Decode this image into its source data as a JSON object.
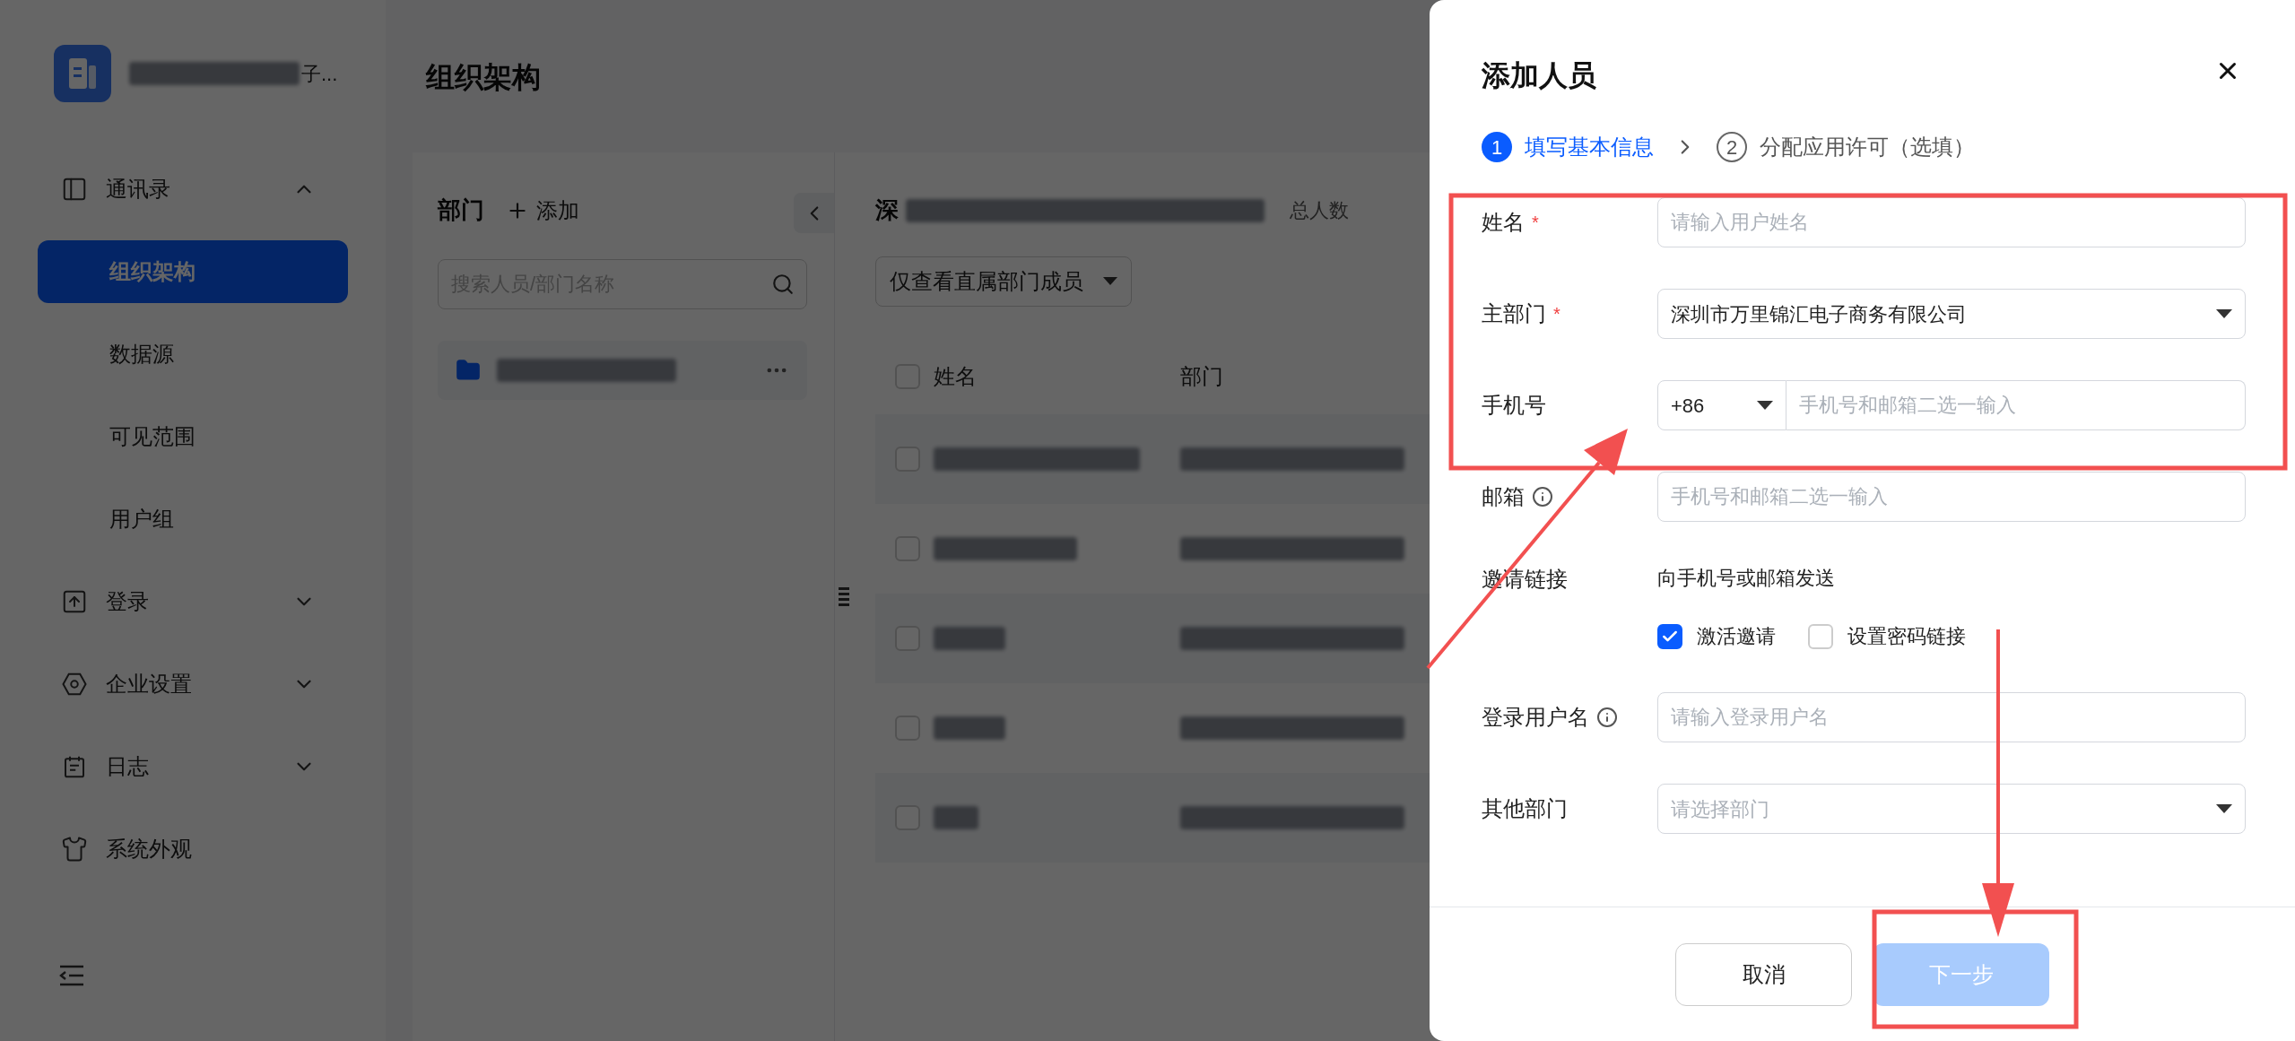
{
  "sidebar": {
    "org_suffix": "子...",
    "items": [
      {
        "kind": "group",
        "label": "通讯录",
        "expanded": true,
        "children": [
          {
            "label": "组织架构",
            "selected": true
          },
          {
            "label": "数据源",
            "selected": false
          },
          {
            "label": "可见范围",
            "selected": false
          },
          {
            "label": "用户组",
            "selected": false
          }
        ]
      },
      {
        "kind": "group",
        "label": "登录",
        "expanded": false
      },
      {
        "kind": "group",
        "label": "企业设置",
        "expanded": false
      },
      {
        "kind": "group",
        "label": "日志",
        "expanded": false
      },
      {
        "kind": "link",
        "label": "系统外观"
      }
    ]
  },
  "header": {
    "title": "组织架构"
  },
  "departments": {
    "title": "部门",
    "add_label": "添加",
    "search": {
      "placeholder": "搜索人员/部门名称"
    }
  },
  "members": {
    "title": "深",
    "count_label": "总人数",
    "filter": "仅查看直属部门成员",
    "all_checked": false,
    "columns": [
      "姓名",
      "部门"
    ],
    "rows": [
      {
        "checked": false
      },
      {
        "checked": false
      },
      {
        "checked": false
      },
      {
        "checked": false
      },
      {
        "checked": false
      }
    ]
  },
  "drawer": {
    "title": "添加人员",
    "steps": [
      {
        "number": "1",
        "label": "填写基本信息",
        "selected": true
      },
      {
        "number": "2",
        "label": "分配应用许可（选填）",
        "selected": false
      }
    ],
    "fields": [
      {
        "kind": "input",
        "label": "姓名",
        "required_mark": "*",
        "info": false,
        "placeholder": "请输入用户姓名"
      },
      {
        "kind": "select",
        "label": "主部门",
        "required_mark": "*",
        "info": false,
        "value": "深圳市万里锦汇电子商务有限公司"
      },
      {
        "kind": "phone",
        "label": "手机号",
        "info": false,
        "prefix": "+86",
        "placeholder": "手机号和邮箱二选一输入"
      },
      {
        "kind": "input",
        "label": "邮箱",
        "info": true,
        "placeholder": "手机号和邮箱二选一输入"
      },
      {
        "kind": "invite",
        "label": "邀请链接",
        "info": false,
        "text": "向手机号或邮箱发送",
        "options": [
          {
            "label": "激活邀请",
            "checked": true
          },
          {
            "label": "设置密码链接",
            "checked": false
          }
        ]
      },
      {
        "kind": "input",
        "label": "登录用户名",
        "info": true,
        "placeholder": "请输入登录用户名"
      },
      {
        "kind": "select",
        "label": "其他部门",
        "info": false,
        "placeholder": "请选择部门"
      }
    ],
    "buttons": [
      {
        "kind": "secondary",
        "label": "取消",
        "disabled": false
      },
      {
        "kind": "primary",
        "label": "下一步",
        "disabled": true
      }
    ]
  }
}
